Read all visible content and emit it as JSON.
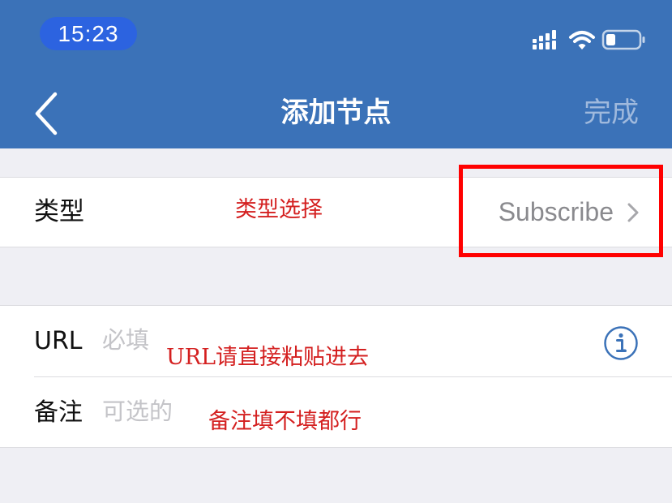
{
  "status_bar": {
    "time": "15:23",
    "icons": [
      "signal-icon",
      "wifi-icon",
      "battery-icon"
    ]
  },
  "nav": {
    "back_icon": "chevron-left-icon",
    "title": "添加节点",
    "done_label": "完成"
  },
  "type_row": {
    "label": "类型",
    "value": "Subscribe",
    "annotation": "类型选择"
  },
  "fields": {
    "url": {
      "label": "URL",
      "placeholder": "必填",
      "value": "",
      "annotation": "URL请直接粘贴进去",
      "icon": "info-icon"
    },
    "note": {
      "label": "备注",
      "placeholder": "可选的",
      "value": "",
      "annotation": "备注填不填都行"
    }
  },
  "colors": {
    "header_bg": "#3b72b8",
    "time_pill": "#2c63e0",
    "accent": "#3b72b8",
    "annotation_red": "#d42020",
    "highlight_box": "#ff0000"
  }
}
